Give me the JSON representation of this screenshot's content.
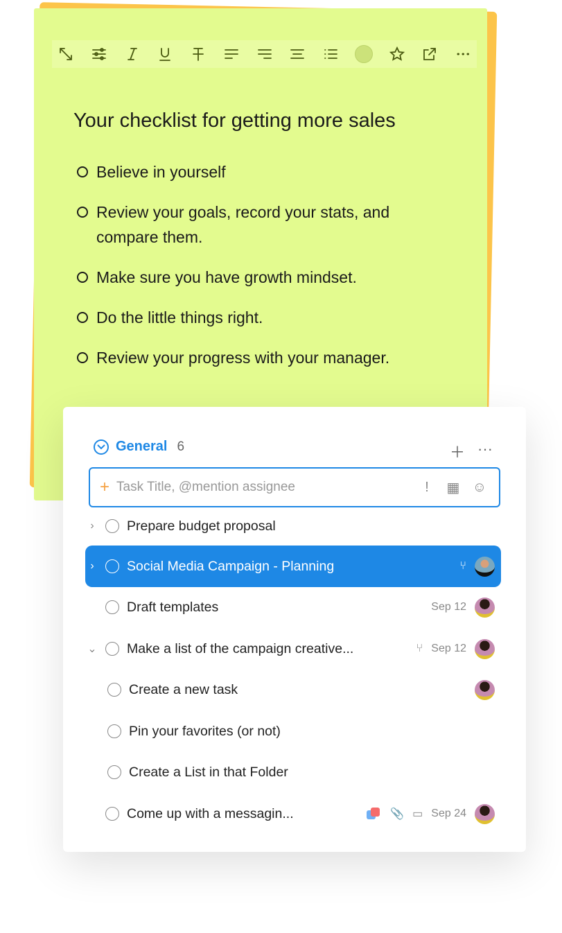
{
  "note": {
    "toolbar": [
      "expand-icon",
      "sliders-icon",
      "italic-icon",
      "underline-icon",
      "strikethrough-icon",
      "align-left-icon",
      "align-right-icon",
      "align-center-icon",
      "bullet-list-icon",
      "numbered-list-icon",
      "color-swatch",
      "star-icon",
      "open-external-icon",
      "more-icon"
    ],
    "note_color": "#e3fb8f",
    "title": "Your checklist for getting more sales",
    "items": [
      "Believe in yourself",
      "Review your goals, record your stats, and compare them.",
      "Make sure you have growth mindset.",
      "Do the little things right.",
      "Review your progress with your manager."
    ]
  },
  "tasks": {
    "group": "General",
    "count": "6",
    "accent": "#1e88e5",
    "input_placeholder": "Task Title, @mention assignee",
    "rows": [
      {
        "label": "Prepare budget proposal",
        "date": ""
      },
      {
        "label": "Social Media Campaign - Planning",
        "date": ""
      },
      {
        "label": "Draft templates",
        "date": "Sep 12"
      },
      {
        "label": "Make a list of the campaign creative...",
        "date": "Sep 12"
      },
      {
        "label": "Create a new task",
        "date": ""
      },
      {
        "label": "Pin your favorites (or not)",
        "date": ""
      },
      {
        "label": "Create a List in that Folder",
        "date": ""
      },
      {
        "label": "Come up with a messagin...",
        "date": "Sep 24"
      }
    ]
  }
}
